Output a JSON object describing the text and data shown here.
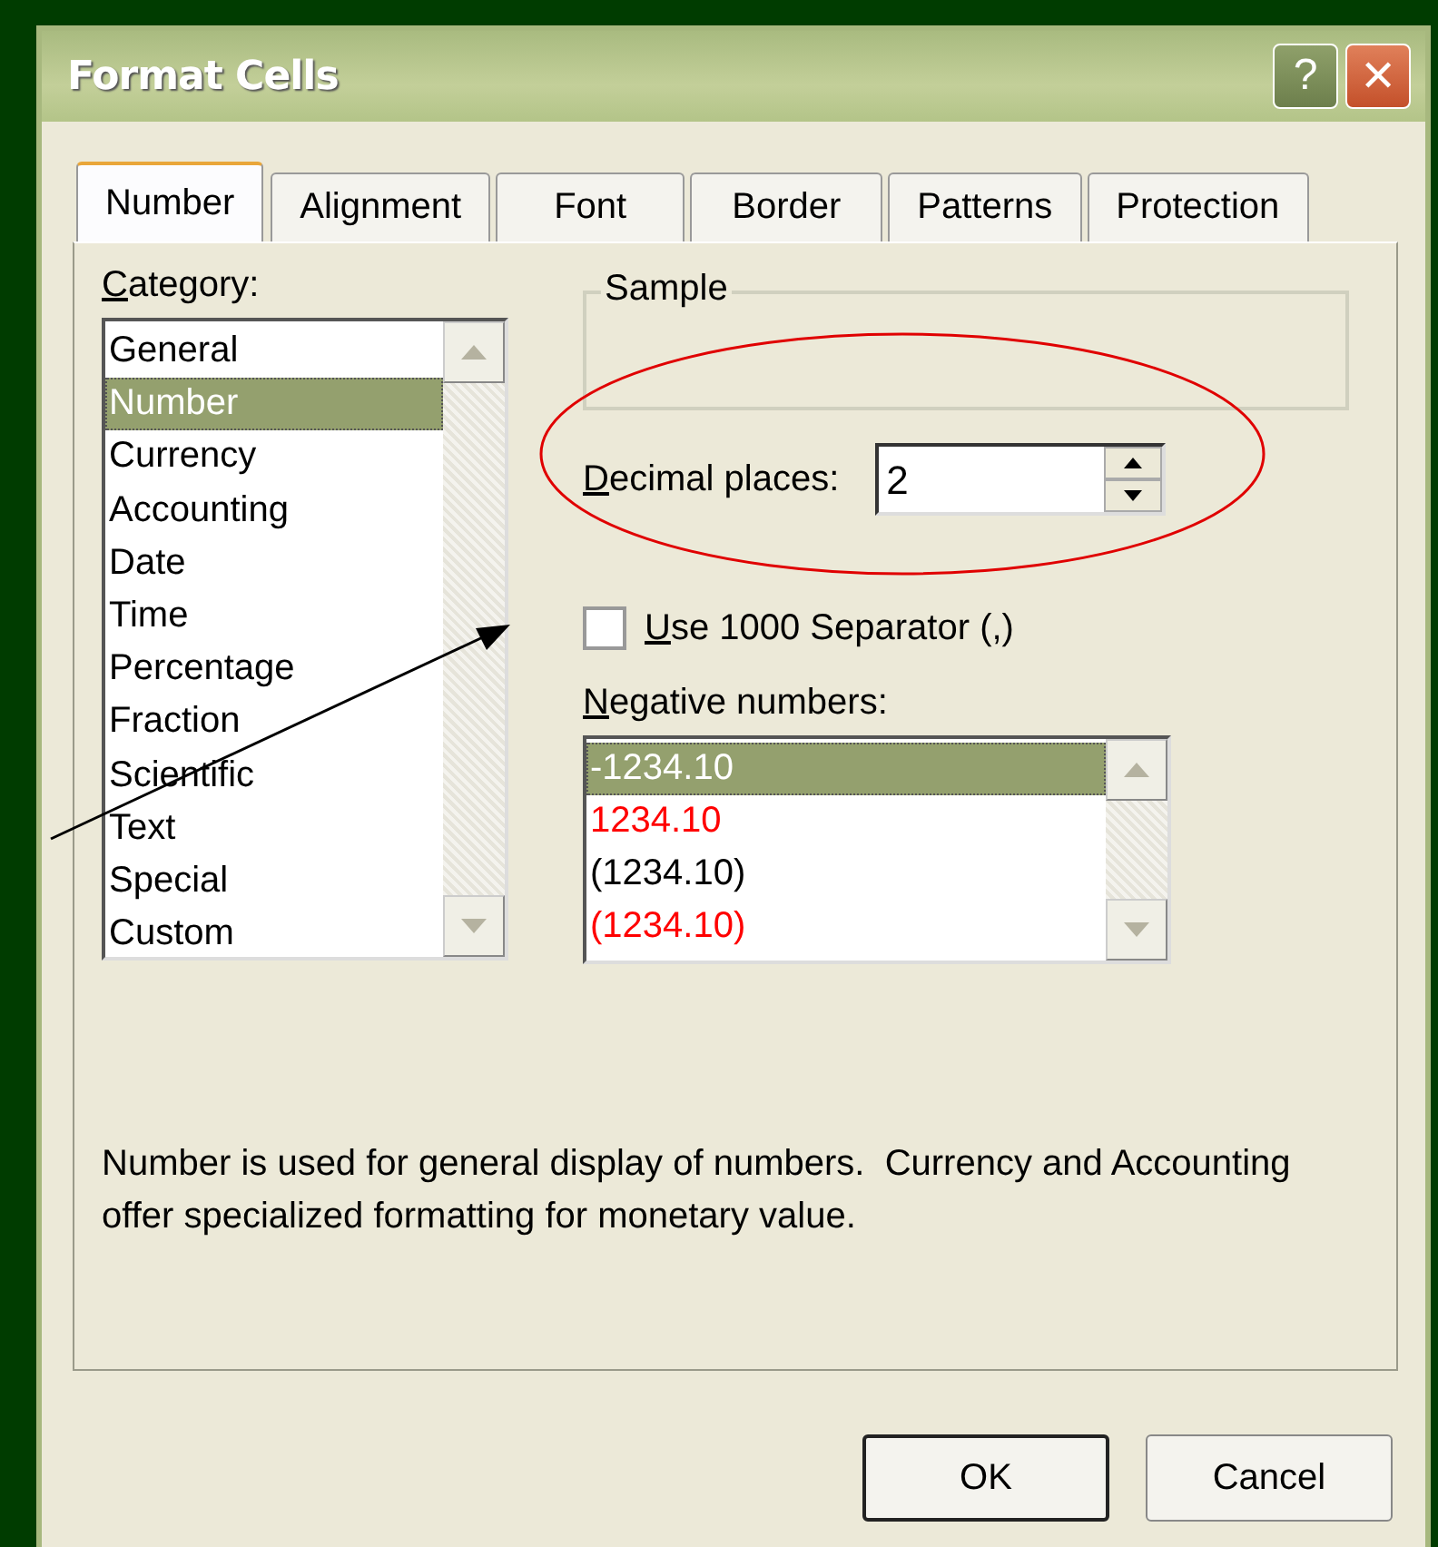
{
  "window": {
    "title": "Format Cells"
  },
  "title_buttons": [
    {
      "kind": "help",
      "label": "?"
    },
    {
      "kind": "close",
      "label": "✕"
    }
  ],
  "tabs": [
    {
      "label": "Number",
      "selected": true
    },
    {
      "label": "Alignment",
      "selected": false
    },
    {
      "label": "Font",
      "selected": false
    },
    {
      "label": "Border",
      "selected": false
    },
    {
      "label": "Patterns",
      "selected": false
    },
    {
      "label": "Protection",
      "selected": false
    }
  ],
  "category": {
    "label": "Category:",
    "items": [
      {
        "text": "General",
        "selected": false
      },
      {
        "text": "Number",
        "selected": true
      },
      {
        "text": "Currency",
        "selected": false
      },
      {
        "text": "Accounting",
        "selected": false
      },
      {
        "text": "Date",
        "selected": false
      },
      {
        "text": "Time",
        "selected": false
      },
      {
        "text": "Percentage",
        "selected": false
      },
      {
        "text": "Fraction",
        "selected": false
      },
      {
        "text": "Scientific",
        "selected": false
      },
      {
        "text": "Text",
        "selected": false
      },
      {
        "text": "Special",
        "selected": false
      },
      {
        "text": "Custom",
        "selected": false
      }
    ]
  },
  "sample": {
    "label": "Sample"
  },
  "decimal_places": {
    "label": "Decimal places:",
    "value": "2"
  },
  "separator": {
    "label": "Use 1000 Separator (,)",
    "checked": false
  },
  "negative_numbers": {
    "label": "Negative numbers:",
    "items": [
      {
        "text": "-1234.10",
        "selected": true
      },
      {
        "text": "1234.10",
        "color": "#ff0000",
        "selected": false
      },
      {
        "text": "(1234.10)",
        "color": "#000000",
        "selected": false
      },
      {
        "text": "(1234.10)",
        "color": "#ff0000",
        "selected": false
      }
    ]
  },
  "description": "Number is used for general display of numbers.  Currency and Accounting offer specialized formatting for monetary value.",
  "buttons": [
    {
      "label": "OK",
      "default": true
    },
    {
      "label": "Cancel",
      "default": false
    }
  ]
}
